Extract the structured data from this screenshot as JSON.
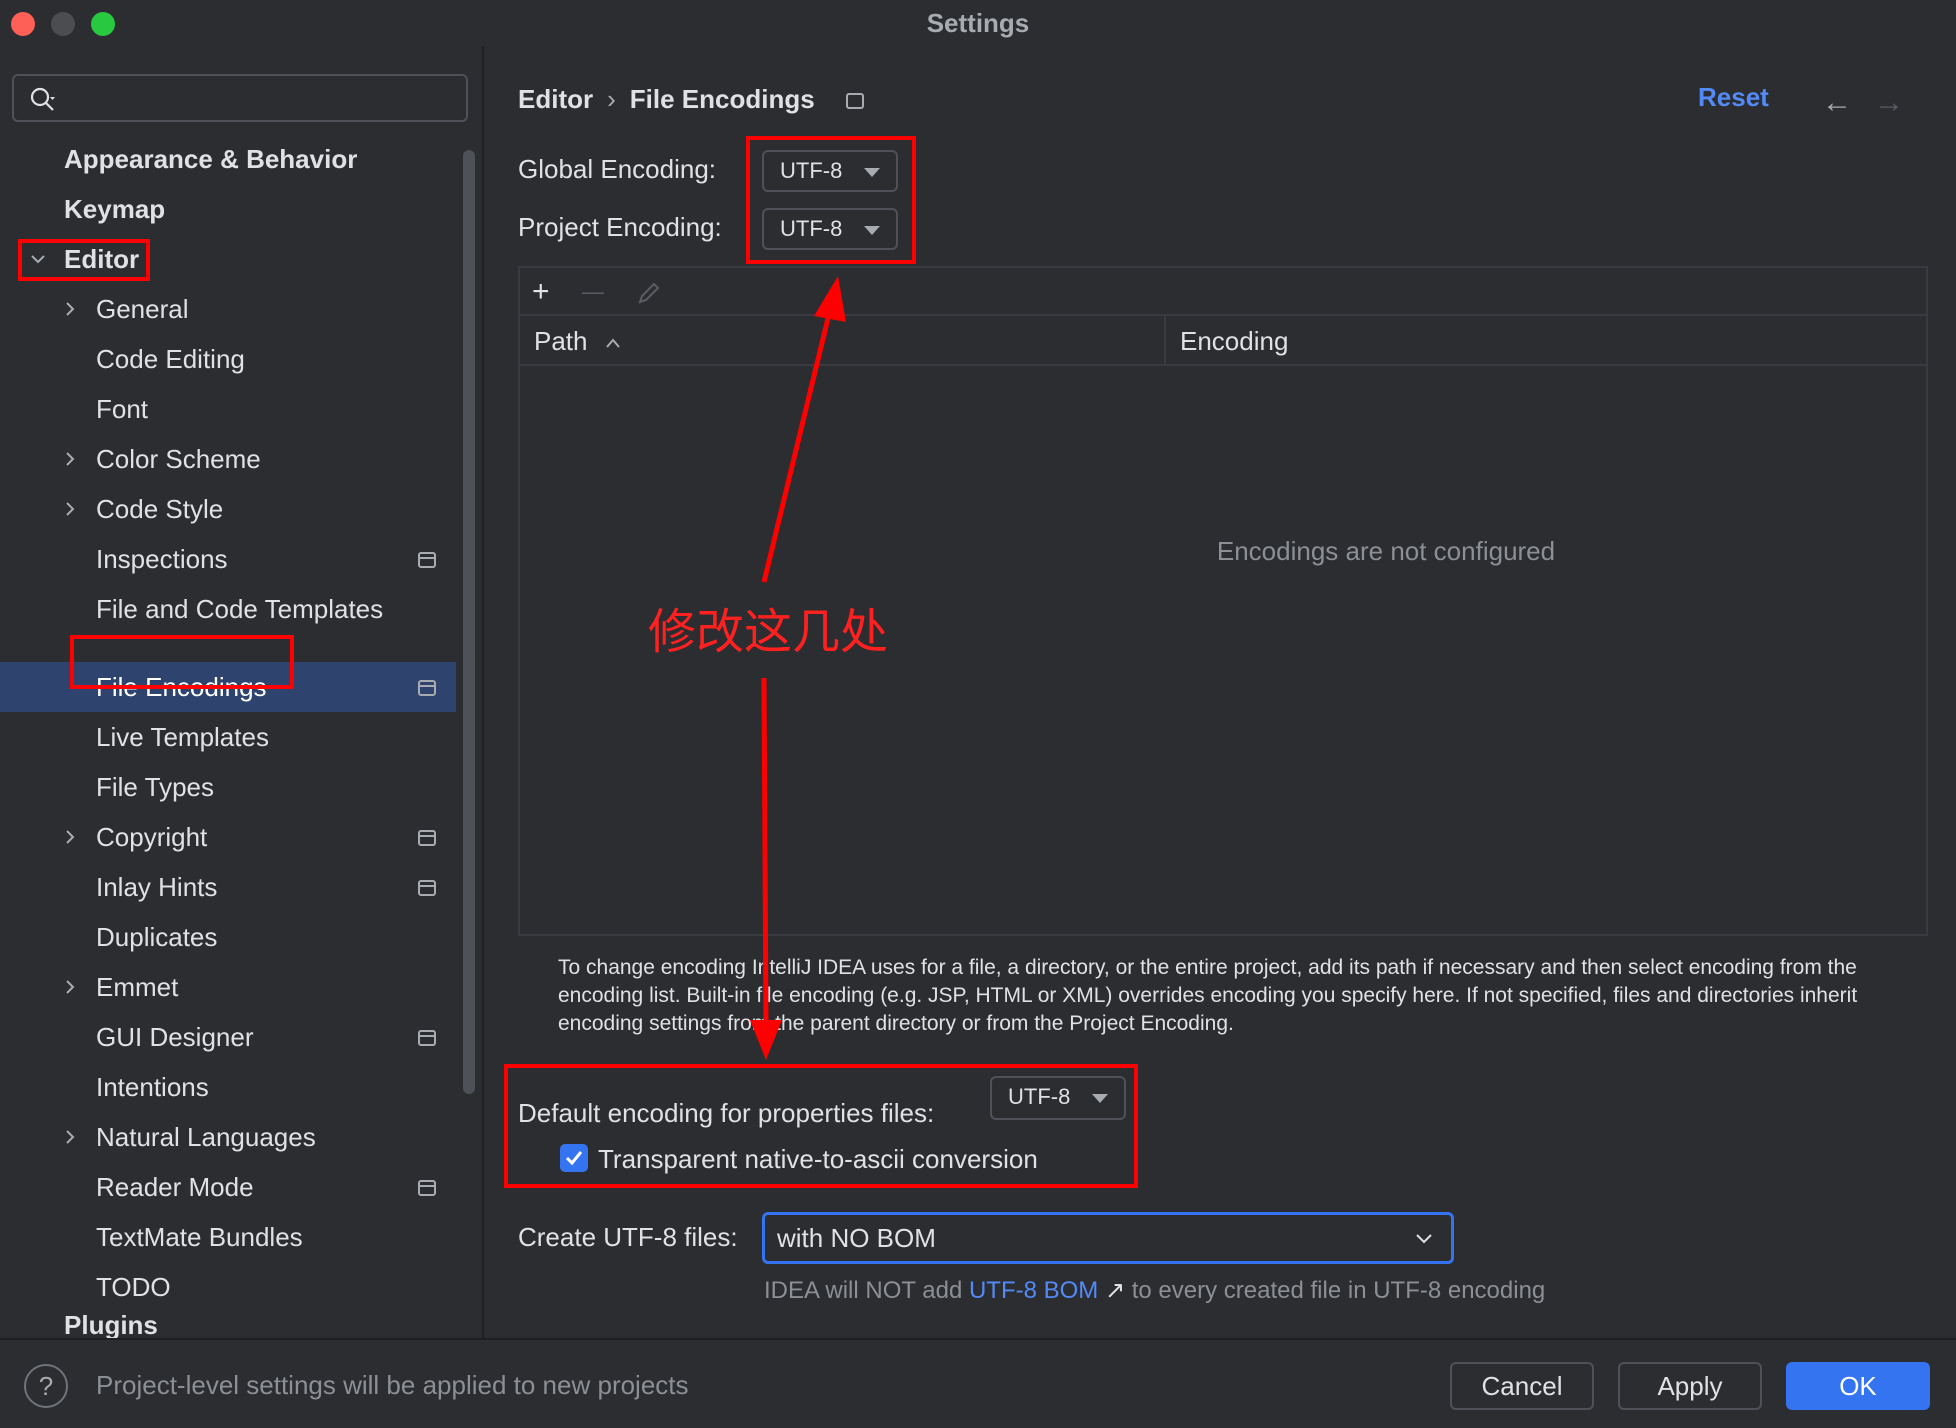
{
  "window": {
    "title": "Settings"
  },
  "sidebar": {
    "search_placeholder": "",
    "items": [
      {
        "label": "Appearance & Behavior"
      },
      {
        "label": "Keymap"
      },
      {
        "label": "Editor"
      },
      {
        "label": "General"
      },
      {
        "label": "Code Editing"
      },
      {
        "label": "Font"
      },
      {
        "label": "Color Scheme"
      },
      {
        "label": "Code Style"
      },
      {
        "label": "Inspections"
      },
      {
        "label": "File and Code Templates"
      },
      {
        "label": "File Encodings"
      },
      {
        "label": "Live Templates"
      },
      {
        "label": "File Types"
      },
      {
        "label": "Copyright"
      },
      {
        "label": "Inlay Hints"
      },
      {
        "label": "Duplicates"
      },
      {
        "label": "Emmet"
      },
      {
        "label": "GUI Designer"
      },
      {
        "label": "Intentions"
      },
      {
        "label": "Natural Languages"
      },
      {
        "label": "Reader Mode"
      },
      {
        "label": "TextMate Bundles"
      },
      {
        "label": "TODO"
      },
      {
        "label": "Plugins"
      }
    ]
  },
  "header": {
    "breadcrumb_parent": "Editor",
    "breadcrumb_separator": "›",
    "breadcrumb_current": "File Encodings",
    "reset_label": "Reset",
    "back_arrow": "←",
    "forward_arrow": "→"
  },
  "encodings": {
    "global_label": "Global Encoding:",
    "global_value": "UTF-8",
    "project_label": "Project Encoding:",
    "project_value": "UTF-8"
  },
  "table": {
    "toolbar": {
      "add": "+",
      "remove": "—"
    },
    "columns": [
      "Path",
      "Encoding"
    ],
    "sort_indicator": "^",
    "empty_text": "Encodings are not configured"
  },
  "help_text": "To change encoding IntelliJ IDEA uses for a file, a directory, or the entire project, add its path if necessary and then select encoding from the encoding list. Built-in file encoding (e.g. JSP, HTML or XML) overrides encoding you specify here. If not specified, files and directories inherit encoding settings from the parent directory or from the Project Encoding.",
  "properties": {
    "label": "Default encoding for properties files:",
    "value": "UTF-8",
    "checkbox_label": "Transparent native-to-ascii conversion",
    "checkbox_checked": true
  },
  "bom": {
    "label": "Create UTF-8 files:",
    "value": "with NO BOM",
    "hint_prefix": "IDEA will NOT add",
    "hint_link": "UTF-8 BOM",
    "hint_link_icon": "↗",
    "hint_suffix": "to every created file in UTF-8 encoding"
  },
  "footer": {
    "help": "?",
    "note": "Project-level settings will be applied to new projects",
    "cancel": "Cancel",
    "apply": "Apply",
    "ok": "OK"
  },
  "annotation": {
    "text": "修改这几处",
    "color": "#ff0000"
  },
  "colors": {
    "accent": "#3574f0",
    "link": "#548af7",
    "selection": "#2e436e",
    "background": "#2b2d30"
  }
}
